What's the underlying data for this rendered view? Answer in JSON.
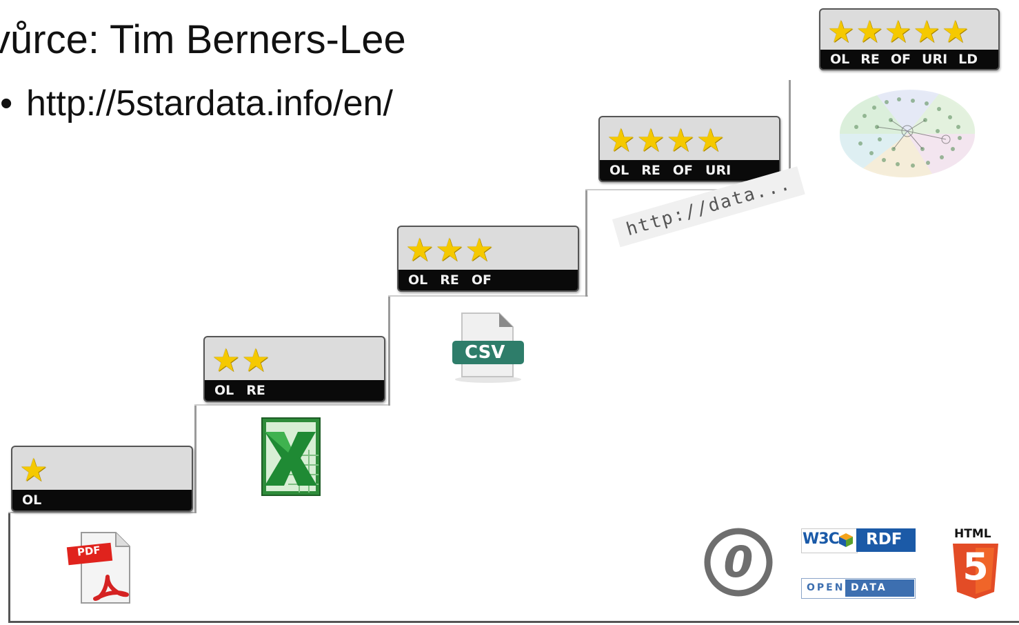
{
  "slide": {
    "title": "vůrce: Tim Berners-Lee",
    "bullet": "http://5stardata.info/en/"
  },
  "star_color": "#f5c900",
  "levels": [
    {
      "stars": 1,
      "codes": [
        "OL"
      ],
      "format": "PDF"
    },
    {
      "stars": 2,
      "codes": [
        "OL",
        "RE"
      ],
      "format": "Excel"
    },
    {
      "stars": 3,
      "codes": [
        "OL",
        "RE",
        "OF"
      ],
      "format": "CSV"
    },
    {
      "stars": 4,
      "codes": [
        "OL",
        "RE",
        "OF",
        "URI"
      ],
      "format": "http://data..."
    },
    {
      "stars": 5,
      "codes": [
        "OL",
        "RE",
        "OF",
        "URI",
        "LD"
      ],
      "format": "Linked data cloud"
    }
  ],
  "icons": {
    "pdf_label": "PDF",
    "csv_label": "CSV",
    "url_text": "http://data...",
    "w3c": "W3C",
    "rdf": "RDF",
    "open": "OPEN",
    "data": "DATA",
    "html": "HTML",
    "html_number": "5",
    "cc_zero": "0"
  }
}
